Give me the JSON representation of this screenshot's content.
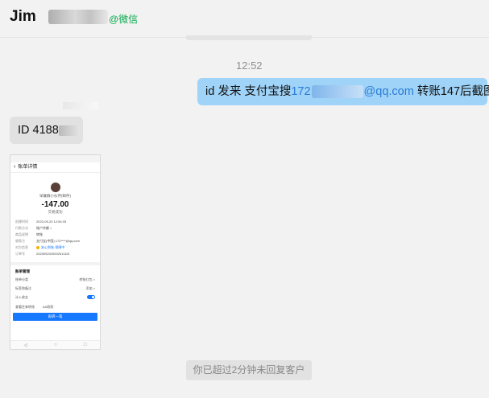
{
  "header": {
    "contact_name": "Jim",
    "source_tag": "@微信"
  },
  "messages": {
    "timestamp": "12:52",
    "outgoing": {
      "prefix": "id  发来   支付宝搜",
      "email_start": "172",
      "email_end": "@qq.com",
      "suffix": "  转账147后截图"
    },
    "incoming_text": {
      "prefix": "ID 4188"
    }
  },
  "phone_screenshot": {
    "status_bar": "",
    "nav_title": "账单详情",
    "merchant": "早餐群小伙伴(邮件)",
    "amount": "-147.00",
    "status": "交易成功",
    "rows": [
      {
        "k": "创建时间",
        "v": "2023-09-20 12:54:33"
      },
      {
        "k": "付款方式",
        "v": "账户余额 >"
      },
      {
        "k": "商品说明",
        "v": "转账"
      },
      {
        "k": "收款方",
        "v": "支付宝(中国) 172****@qq.com"
      },
      {
        "k": "对方信息",
        "v": "安心到账·保障中"
      },
      {
        "k": "订单号",
        "v": "2023092020002011115"
      }
    ],
    "section_title": "账单管理",
    "lines": [
      {
        "label": "账单分类",
        "value": "转账红包 >"
      },
      {
        "label": "标签和备注",
        "value": "添加 >"
      },
      {
        "label": "计入收支",
        "value": ""
      }
    ],
    "links": [
      "查看往来转账",
      "AA收款"
    ],
    "button": "再转一笔",
    "nav_buttons": [
      "◁",
      "○",
      "□"
    ]
  },
  "system_notice": "你已超过2分钟未回复客户",
  "colors": {
    "background": "#f2f2f2",
    "outgoing_bubble": "#9fd3f7",
    "incoming_bubble": "#e1e1e1",
    "link_blue": "#2b7bd8",
    "wechat_green": "#07a84b"
  }
}
